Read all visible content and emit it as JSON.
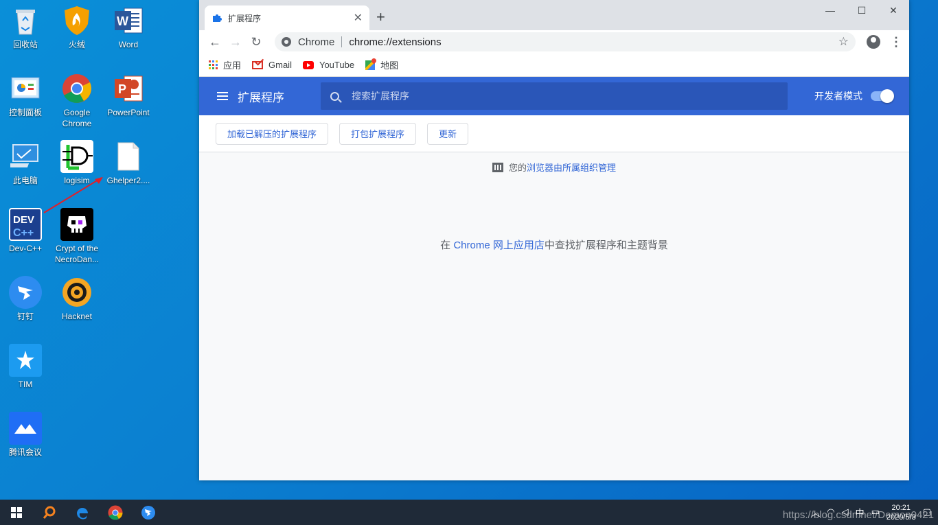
{
  "desktop": {
    "icons": [
      {
        "label": "回收站",
        "icon": "recycle-bin-icon"
      },
      {
        "label": "火绒",
        "icon": "huorong-icon"
      },
      {
        "label": "Word",
        "icon": "word-icon"
      },
      {
        "label": "控制面板",
        "icon": "control-panel-icon"
      },
      {
        "label": "Google\nChrome",
        "icon": "chrome-icon"
      },
      {
        "label": "PowerPoint",
        "icon": "powerpoint-icon"
      },
      {
        "label": "此电脑",
        "icon": "this-pc-icon"
      },
      {
        "label": "logisim",
        "icon": "logisim-icon"
      },
      {
        "label": "Ghelper2....",
        "icon": "file-icon"
      },
      {
        "label": "Dev-C++",
        "icon": "devcpp-icon"
      },
      {
        "label": "Crypt of the\nNecroDan...",
        "icon": "crypt-necrodancer-icon"
      },
      {
        "label": "钉钉",
        "icon": "dingtalk-icon"
      },
      {
        "label": "Hacknet",
        "icon": "hacknet-icon"
      },
      {
        "label": "TIM",
        "icon": "tim-icon"
      },
      {
        "label": "腾讯会议",
        "icon": "tencent-meeting-icon"
      }
    ]
  },
  "browser": {
    "tab_title": "扩展程序",
    "omnibox_chip": "Chrome",
    "url": "chrome://extensions",
    "bookmarks": [
      {
        "label": "应用",
        "icon": "apps-grid-icon"
      },
      {
        "label": "Gmail",
        "icon": "gmail-icon"
      },
      {
        "label": "YouTube",
        "icon": "youtube-icon"
      },
      {
        "label": "地图",
        "icon": "maps-icon"
      }
    ]
  },
  "extensions": {
    "title": "扩展程序",
    "search_placeholder": "搜索扩展程序",
    "dev_mode_label": "开发者模式",
    "dev_mode_on": true,
    "buttons": {
      "load_unpacked": "加载已解压的扩展程序",
      "pack": "打包扩展程序",
      "update": "更新"
    },
    "managed_prefix": "您的",
    "managed_link": "浏览器由所属组织管理",
    "store_prefix": "在 ",
    "store_link": "Chrome 网上应用店",
    "store_suffix": "中查找扩展程序和主题背景"
  },
  "taskbar": {
    "time": "20:21",
    "date": "2020/5/3",
    "watermark": "https://blog.csdn.net/Demon0421"
  },
  "colors": {
    "accent": "#3367d6",
    "desktop_bg": "#0b7fd0",
    "taskbar_bg": "#1f2a38"
  }
}
